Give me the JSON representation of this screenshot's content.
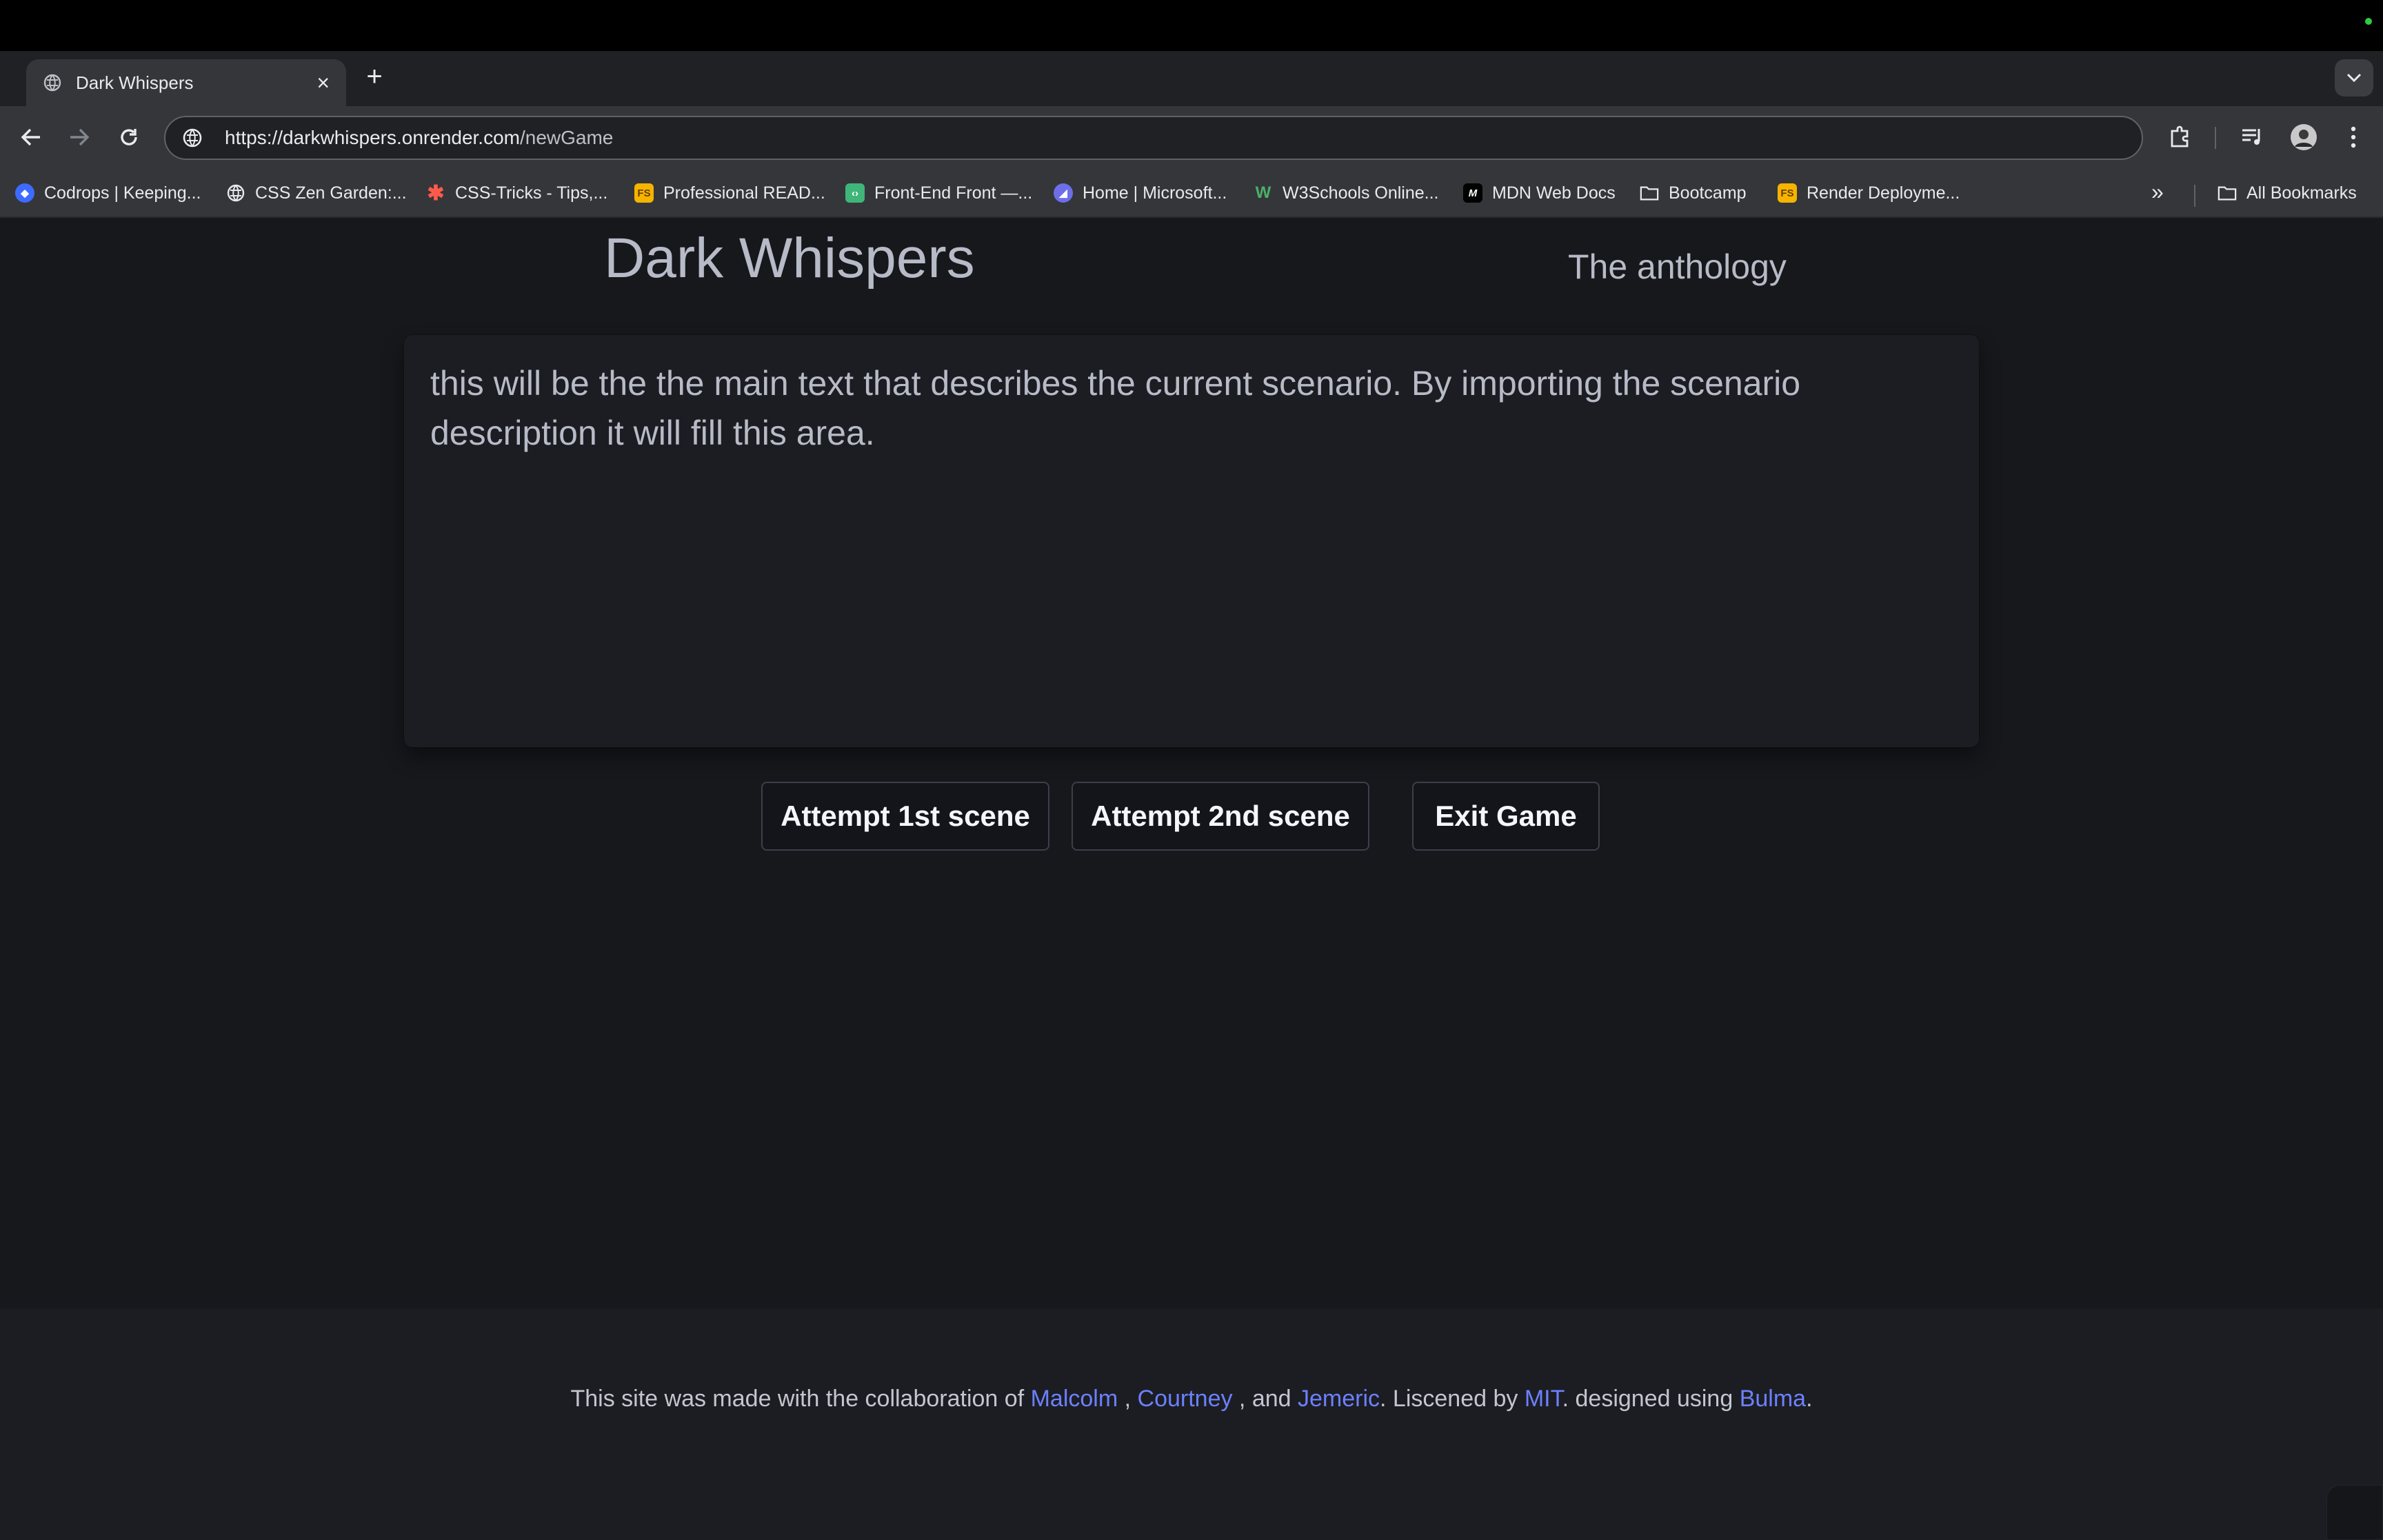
{
  "browser": {
    "tab_title": "Dark Whispers",
    "url_host": "https://darkwhispers.onrender.com",
    "url_path": "/newGame",
    "bookmarks": [
      {
        "label": "Codrops | Keeping...",
        "icon": "codrops-icon"
      },
      {
        "label": "CSS Zen Garden:...",
        "icon": "globe-icon"
      },
      {
        "label": "CSS-Tricks - Tips,...",
        "icon": "css-tricks-icon"
      },
      {
        "label": "Professional READ...",
        "icon": "fs-icon"
      },
      {
        "label": "Front-End Front —...",
        "icon": "frontend-icon"
      },
      {
        "label": "Home | Microsoft...",
        "icon": "microsoft-icon"
      },
      {
        "label": "W3Schools Online...",
        "icon": "w3schools-icon"
      },
      {
        "label": "MDN Web Docs",
        "icon": "mdn-icon"
      },
      {
        "label": "Bootcamp",
        "icon": "folder-icon"
      },
      {
        "label": "Render Deployme...",
        "icon": "fs-icon"
      }
    ],
    "all_bookmarks": "All Bookmarks"
  },
  "site": {
    "title": "Dark Whispers",
    "subtitle": "The anthology"
  },
  "scenario": {
    "text": "this will be the the main text that describes the current scenario. By importing the scenario description it will fill this area."
  },
  "actions": {
    "attempt1": "Attempt 1st scene",
    "attempt2": "Attempt 2nd scene",
    "exit": "Exit Game"
  },
  "footer": {
    "t1": "This site was made with the collaboration of ",
    "malcolm": "Malcolm",
    "t2": " , ",
    "courtney": "Courtney",
    "t3": " , and ",
    "jemeric": "Jemeric",
    "t4": ". Liscened by ",
    "mit": "MIT",
    "t5": ". designed using ",
    "bulma": "Bulma",
    "t6": "."
  },
  "colors": {
    "page_bg": "#17181c",
    "text": "#b7bbc7",
    "link": "#6c80ff"
  }
}
